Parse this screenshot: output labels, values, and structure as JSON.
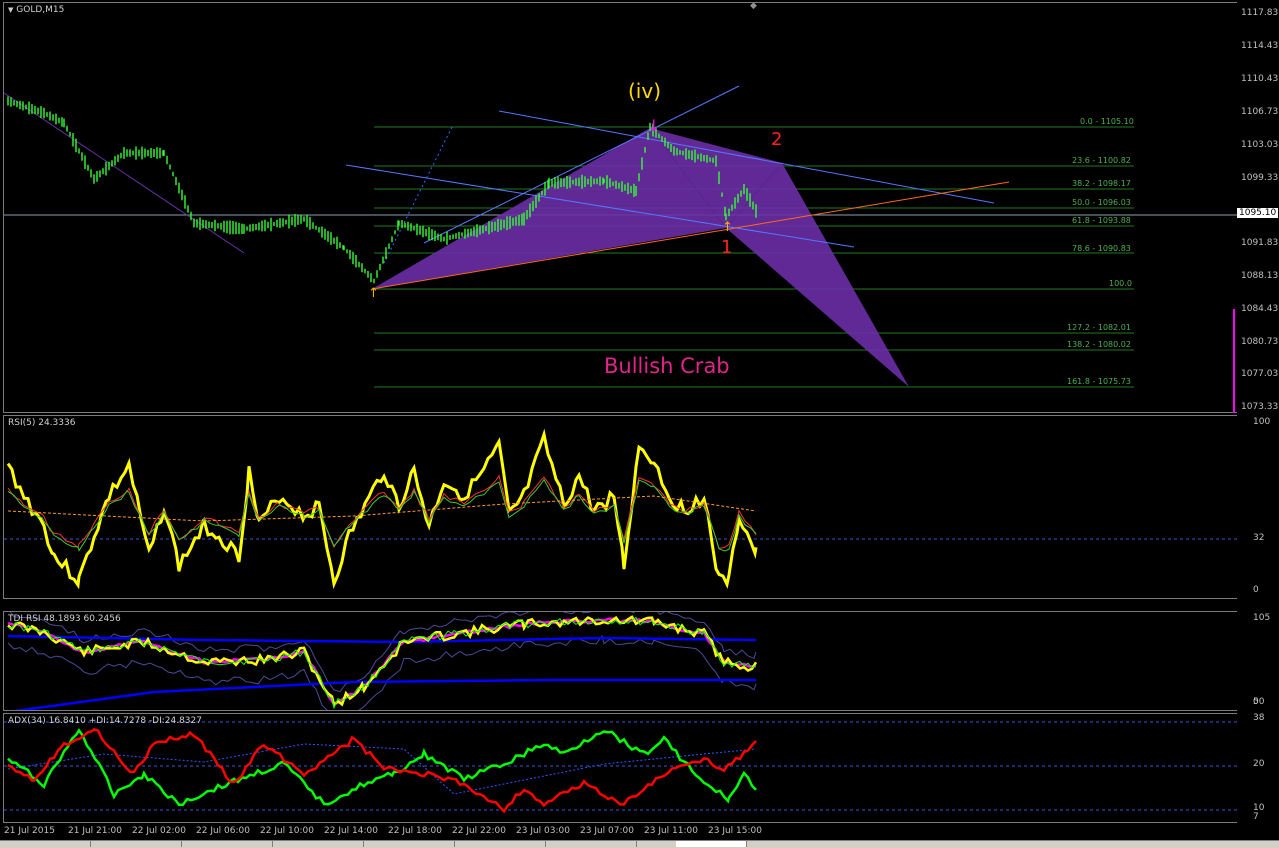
{
  "window": {
    "symbol_label": "GOLD,M15",
    "menu_arrow_icon": "triangle-down-icon"
  },
  "price_axis": {
    "labels": [
      "1117.83",
      "1114.43",
      "1110.43",
      "1106.73",
      "1103.03",
      "1099.33",
      "1095.10",
      "1091.83",
      "1088.13",
      "1084.43",
      "1080.73",
      "1077.03",
      "1073.33"
    ],
    "current_price": "1095.10"
  },
  "fib_levels": [
    "0.0 - 1105.10",
    "23.6 - 1100.82",
    "38.2 - 1098.17",
    "50.0 - 1096.03",
    "61.8 - 1093.88",
    "78.6 - 1090.83",
    "100.0",
    "127.2 - 1082.01",
    "138.2 - 1080.02",
    "161.8 - 1075.73"
  ],
  "annotations": {
    "wave_label": "(iv)",
    "point_1": "1",
    "point_2": "2",
    "pattern_name": "Bullish Crab"
  },
  "rsi_pane": {
    "title": "RSI(5) 24.3336",
    "levels": [
      "100",
      "32",
      "0"
    ]
  },
  "tdi_pane": {
    "title": "TDI RSI 48.1893 60.2456",
    "levels": [
      "105",
      "50",
      "0"
    ]
  },
  "adx_pane": {
    "title": "ADX(34) 16.8410 +DI:14.7278 -DI:24.8327",
    "levels": [
      "38",
      "20",
      "10",
      "7"
    ]
  },
  "time_axis": [
    "21 Jul 2015",
    "21 Jul 21:00",
    "22 Jul 02:00",
    "22 Jul 06:00",
    "22 Jul 10:00",
    "22 Jul 14:00",
    "22 Jul 18:00",
    "22 Jul 22:00",
    "23 Jul 03:00",
    "23 Jul 07:00",
    "23 Jul 11:00",
    "23 Jul 15:00"
  ],
  "colors": {
    "candle": "#33ff33",
    "pattern": "#6a2ea6",
    "rsi": "#ffff00",
    "adx_plus": "#00ff00",
    "adx_minus": "#ff0000",
    "tdi_blue": "#0000ff",
    "tdi_magenta": "#ff00ff",
    "pattern_label": "#e0248a",
    "wave_label": "#ffd800"
  }
}
